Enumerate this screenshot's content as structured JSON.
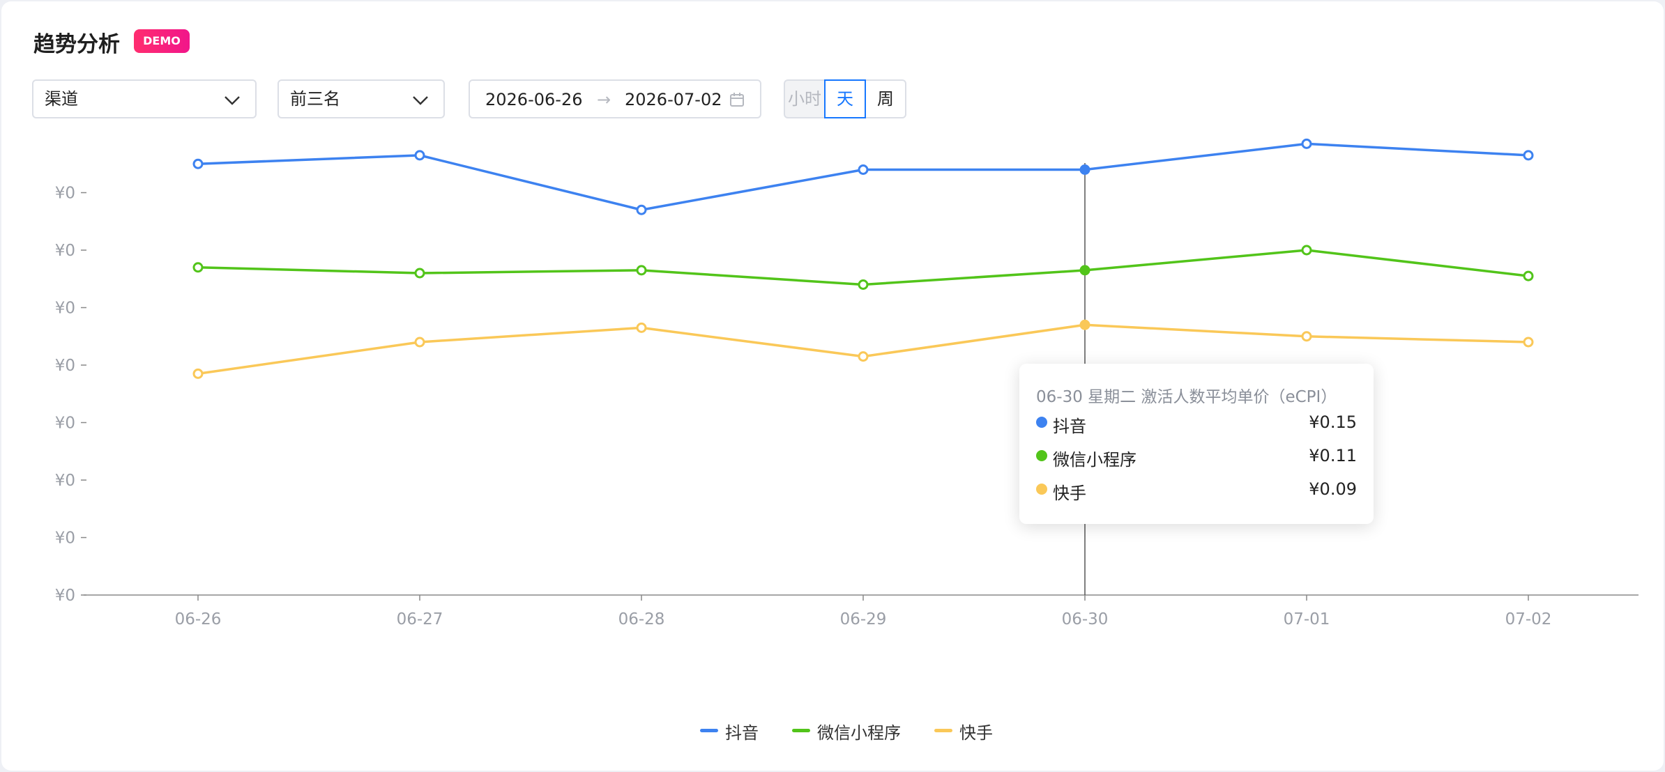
{
  "header": {
    "title": "趋势分析",
    "badge": "DEMO"
  },
  "filters": {
    "channel": "渠道",
    "rank": "前三名",
    "date_start": "2026-06-26",
    "date_sep": "→",
    "date_end": "2026-07-02",
    "granularity": [
      "小时",
      "天",
      "周"
    ],
    "granularity_selected": "天"
  },
  "colors": {
    "douyin": "#3d82f0",
    "weixin": "#52c41a",
    "kuaishou": "#fac858",
    "axis": "#888888",
    "cursor": "#555555"
  },
  "chart_data": {
    "type": "line",
    "x": [
      "06-26",
      "06-27",
      "06-28",
      "06-29",
      "06-30",
      "07-01",
      "07-02"
    ],
    "y_tick_labels": [
      "¥0",
      "¥0",
      "¥0",
      "¥0",
      "¥0",
      "¥0",
      "¥0",
      "¥0"
    ],
    "ylim": [
      0,
      0.16
    ],
    "y_ticks": [
      0,
      0.02,
      0.04,
      0.06,
      0.08,
      0.1,
      0.12,
      0.14
    ],
    "grid": false,
    "legend": "bottom",
    "series": [
      {
        "name": "抖音",
        "color": "#3d82f0",
        "values": [
          0.15,
          0.153,
          0.134,
          0.148,
          0.148,
          0.157,
          0.153
        ]
      },
      {
        "name": "微信小程序",
        "color": "#52c41a",
        "values": [
          0.114,
          0.112,
          0.113,
          0.108,
          0.113,
          0.12,
          0.111
        ]
      },
      {
        "name": "快手",
        "color": "#fac858",
        "values": [
          0.077,
          0.088,
          0.093,
          0.083,
          0.094,
          0.09,
          0.088
        ]
      }
    ],
    "tooltip": {
      "index": 4,
      "header": "06-30 星期二   激活人数平均单价（eCPI）",
      "items": [
        {
          "name": "抖音",
          "value": "¥0.15",
          "color": "#3d82f0"
        },
        {
          "name": "微信小程序",
          "value": "¥0.11",
          "color": "#52c41a"
        },
        {
          "name": "快手",
          "value": "¥0.09",
          "color": "#fac858"
        }
      ]
    }
  }
}
